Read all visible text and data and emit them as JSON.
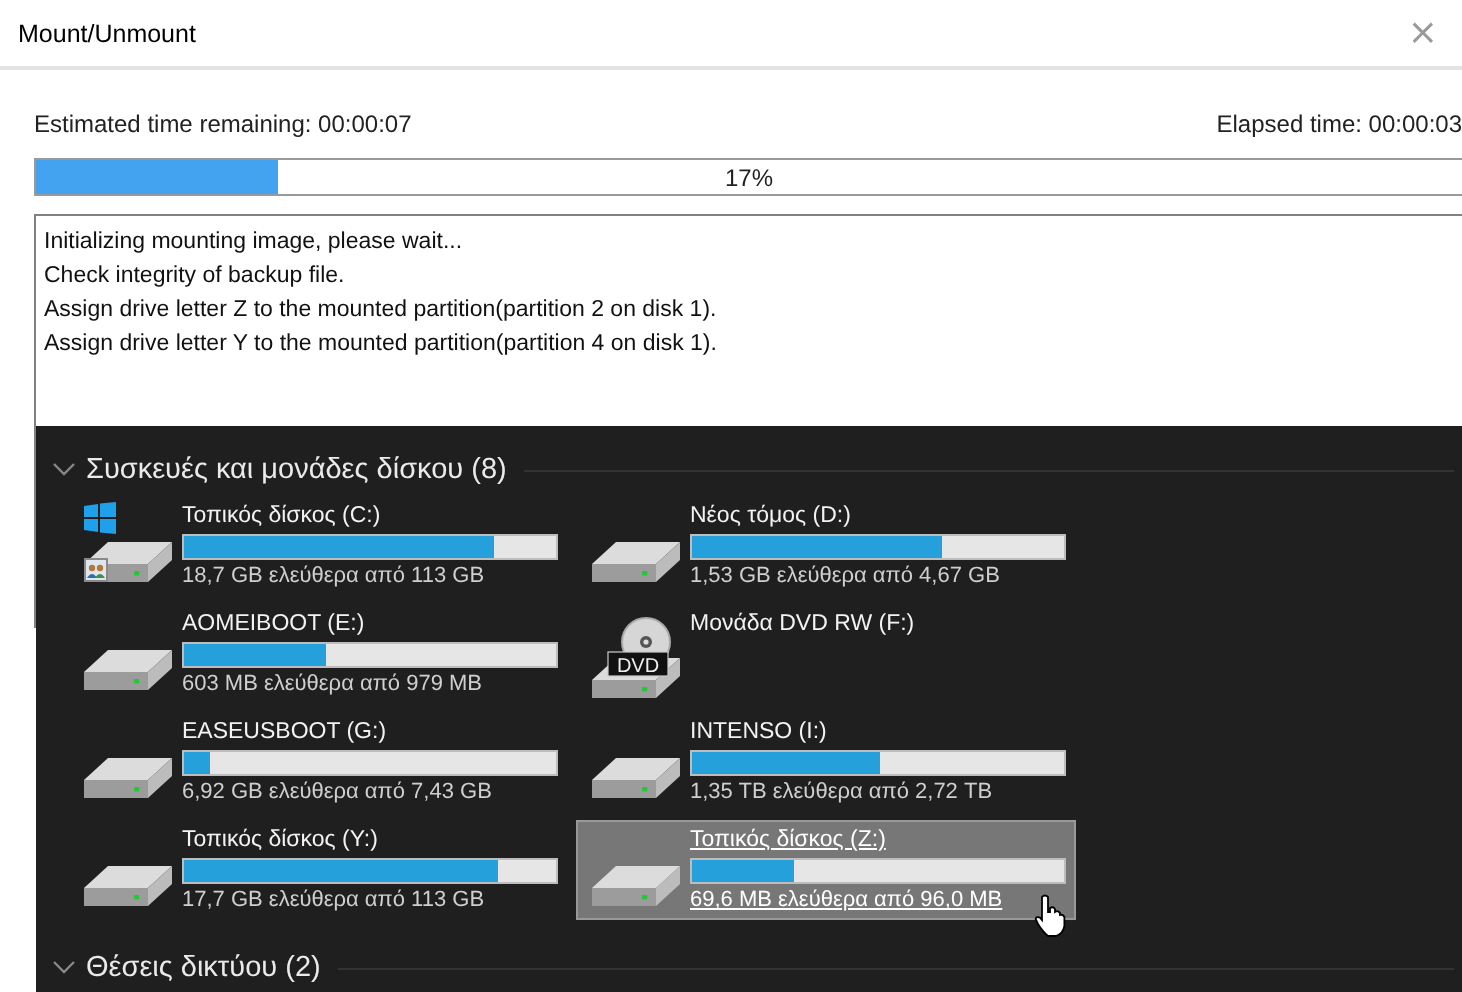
{
  "window": {
    "title": "Mount/Unmount",
    "close": "×"
  },
  "progress": {
    "remaining": "Estimated time remaining: 00:00:07",
    "elapsed": "Elapsed time: 00:00:03",
    "level": 0.17,
    "reading": "17%"
  },
  "log": [
    "Initializing mounting image, please wait...",
    "Check integrity of backup file.",
    "Assign drive letter Z to the mounted partition(partition 2 on disk 1).",
    "Assign drive letter Y to the mounted partition(partition 4 on disk 1)."
  ],
  "explorer": {
    "sections": [
      {
        "title": "Συσκευές και μονάδες δίσκου (8)",
        "expanded": true,
        "drives": [
          {
            "kind": "system",
            "name": "Τοπικός δίσκος (C:)",
            "level": 0.835,
            "free": "18,7 GB ελεύθερα από 113 GB",
            "selected": false
          },
          {
            "kind": "drive",
            "name": "Νέος τόμος (D:)",
            "level": 0.672,
            "free": "1,53 GB ελεύθερα από 4,67 GB",
            "selected": false
          },
          {
            "kind": "drive",
            "name": "AOMEIBOOT (E:)",
            "level": 0.384,
            "free": "603 MB ελεύθερα από 979 MB",
            "selected": false
          },
          {
            "kind": "dvd",
            "name": "Μονάδα DVD RW (F:)",
            "icon_label": "DVD",
            "selected": false
          },
          {
            "kind": "drive",
            "name": "EASEUSBOOT (G:)",
            "level": 0.069,
            "free": "6,92 GB ελεύθερα από 7,43 GB",
            "selected": false
          },
          {
            "kind": "drive",
            "name": "INTENSO (I:)",
            "level": 0.504,
            "free": "1,35 TB ελεύθερα από 2,72 TB",
            "selected": false
          },
          {
            "kind": "drive",
            "name": "Τοπικός δίσκος (Y:)",
            "level": 0.843,
            "free": "17,7 GB ελεύθερα από 113 GB",
            "selected": false
          },
          {
            "kind": "drive",
            "name": "Τοπικός δίσκος (Z:)",
            "level": 0.275,
            "free": "69,6 MB ελεύθερα από 96,0 MB",
            "selected": true
          }
        ]
      },
      {
        "title": "Θέσεις δικτύου (2)",
        "expanded": true
      }
    ]
  }
}
